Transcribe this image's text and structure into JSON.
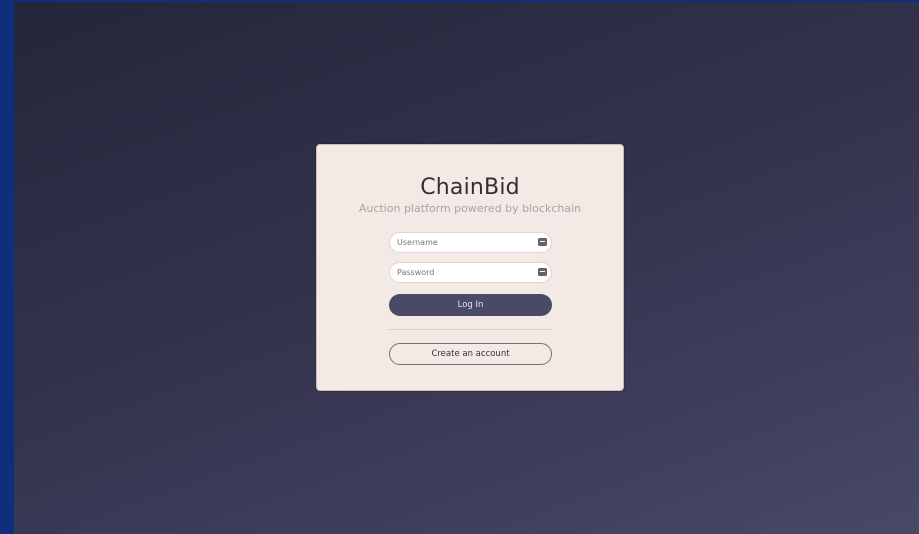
{
  "app": {
    "title": "ChainBid",
    "subtitle": "Auction platform powered by blockchain"
  },
  "form": {
    "username": {
      "placeholder": "Username",
      "value": "",
      "icon": "id-card-icon"
    },
    "password": {
      "placeholder": "Password",
      "value": "",
      "icon": "id-card-icon"
    },
    "login_label": "Log In",
    "create_account_label": "Create an account"
  },
  "colors": {
    "background_start": "#25253a",
    "background_end": "#484868",
    "card": "#f3e9e5",
    "primary_button": "#4a4a66",
    "title_text": "#3b2b30",
    "subtitle_text": "#aaa2a4"
  }
}
